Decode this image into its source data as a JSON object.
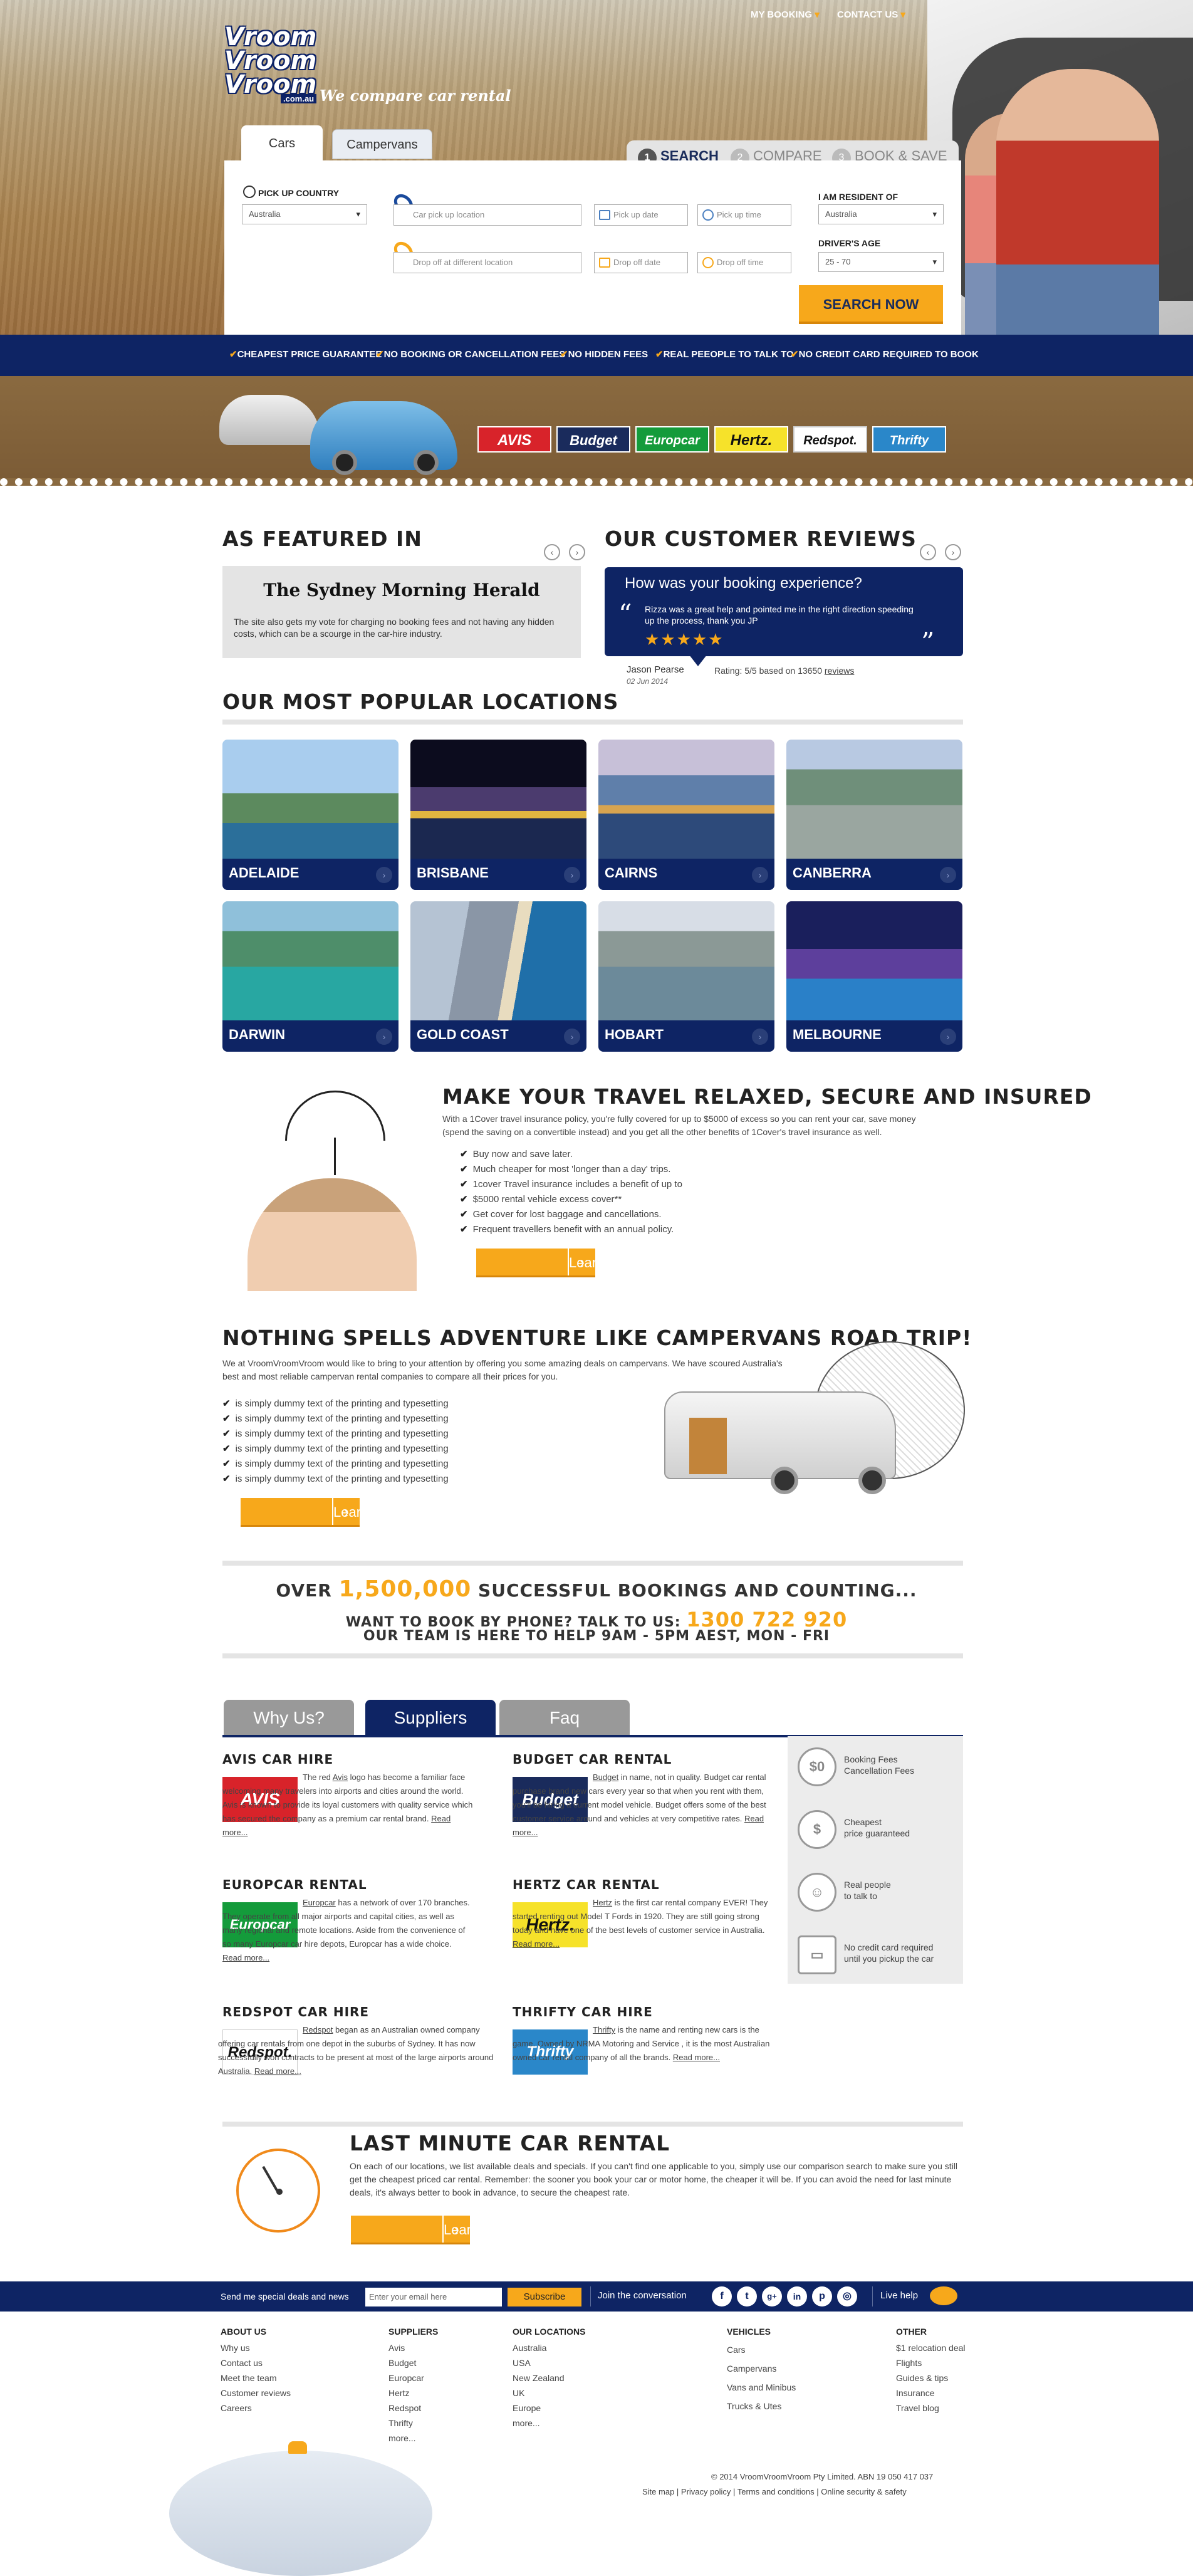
{
  "header": {
    "nav": [
      "MY BOOKING",
      "CONTACT US"
    ],
    "logo_lines": [
      "Vroom",
      "Vroom",
      "Vroom"
    ],
    "logo_domain": ".com.au",
    "tagline": "We compare car rental"
  },
  "search": {
    "tabs": [
      "Cars",
      "Campervans"
    ],
    "steps": [
      {
        "n": "1",
        "label": "SEARCH"
      },
      {
        "n": "2",
        "label": "COMPARE"
      },
      {
        "n": "3",
        "label": "BOOK & SAVE"
      }
    ],
    "pickup_country_label": "PICK UP COUNTRY",
    "pickup_country_value": "Australia",
    "pickup_location_placeholder": "Car pick up location",
    "dropoff_location_placeholder": "Drop off at different location",
    "pickup_date_placeholder": "Pick up date",
    "pickup_time_placeholder": "Pick up time",
    "dropoff_date_placeholder": "Drop off date",
    "dropoff_time_placeholder": "Drop off time",
    "resident_label": "I AM RESIDENT OF",
    "resident_value": "Australia",
    "age_label": "DRIVER'S AGE",
    "age_value": "25 - 70",
    "search_button": "SEARCH NOW"
  },
  "usps": [
    "CHEAPEST PRICE GUARANTEE",
    "NO BOOKING OR CANCELLATION FEES",
    "NO HIDDEN FEES",
    "REAL PEEOPLE TO TALK TO",
    "NO CREDIT CARD REQUIRED TO BOOK"
  ],
  "brands": [
    "AVIS",
    "Budget",
    "Europcar",
    "Hertz.",
    "Redspot.",
    "Thrifty"
  ],
  "featured": {
    "title": "AS FEATURED IN",
    "paper": "The Sydney Morning Herald",
    "quote": "The site also gets my vote for charging no booking fees and not having any hidden costs, which can be a scourge in the car-hire industry."
  },
  "reviews": {
    "title": "OUR CUSTOMER REVIEWS",
    "question": "How was your booking experience?",
    "text": "Rizza was a great help and pointed me in the right direction speeding up the process, thank you JP",
    "stars": 5,
    "author": "Jason Pearse",
    "date": "02 Jun 2014",
    "rating_text": "Rating: 5/5 based on 13650",
    "reviews_link": "reviews"
  },
  "locations": {
    "title": "OUR MOST POPULAR LOCATIONS",
    "items": [
      "ADELAIDE",
      "BRISBANE",
      "CAIRNS",
      "CANBERRA",
      "DARWIN",
      "GOLD COAST",
      "HOBART",
      "MELBOURNE"
    ]
  },
  "insurance": {
    "title": "MAKE YOUR TRAVEL RELAXED, SECURE AND INSURED",
    "intro": "With a 1Cover travel insurance policy, you're fully covered for up to $5000 of excess so you can rent your car, save money (spend the saving on a convertible instead) and you get all the other benefits of 1Cover's travel insurance as well.",
    "points": [
      "Buy now and save later.",
      "Much cheaper for most 'longer than a day' trips.",
      "1cover Travel insurance includes a benefit of up to",
      "$5000 rental vehicle excess cover**",
      "Get cover for lost baggage and cancellations.",
      "Frequent travellers benefit with an annual policy."
    ],
    "button": "Learn more"
  },
  "campervans": {
    "title": "NOTHING SPELLS ADVENTURE LIKE CAMPERVANS ROAD TRIP!",
    "intro": "We at VroomVroomVroom would like to bring to your attention by offering you some amazing deals on campervans. We have scoured Australia's best and most reliable campervan rental companies to compare all their prices for you.",
    "points": [
      "is simply dummy text of the printing and typesetting",
      "is simply dummy text of the printing and typesetting",
      "is simply dummy text of the printing and typesetting",
      "is simply dummy text of the printing and typesetting",
      "is simply dummy text of the printing and typesetting",
      "is simply dummy text of the printing and typesetting"
    ],
    "button": "Learn more"
  },
  "stats": {
    "line1_pre": "OVER",
    "bookings": "1,500,000",
    "line1_post": "SUCCESSFUL BOOKINGS AND COUNTING...",
    "line2_pre": "WANT TO BOOK BY PHONE? TALK TO US:",
    "phone": "1300 722 920",
    "line3": "OUR TEAM IS HERE TO HELP 9AM - 5PM AEST, MON - FRI"
  },
  "info_tabs": [
    "Why Us?",
    "Suppliers",
    "Faq"
  ],
  "suppliers": [
    {
      "title": "AVIS CAR HIRE",
      "logo": "AVIS",
      "text_pre": "The red ",
      "link": "Avis",
      "text": " logo has become a familiar face welcoming many travelers into airports and cities around the world. Avis is known to provide its loyal customers with quality service which has secured the company as a premium car rental brand.",
      "more": "Read more..."
    },
    {
      "title": "BUDGET CAR RENTAL",
      "logo": "Budget",
      "text_pre": "",
      "link": "Budget",
      "text": " in name, not in quality. Budget car rental purchase brand new cars every year so that when you rent with them, you'll be hiring a current model vehicle. Budget offers some of the best customer service around and vehicles at very competitive rates.",
      "more": "Read more..."
    },
    {
      "title": "EUROPCAR RENTAL",
      "logo": "Europcar",
      "text_pre": "",
      "link": "Europcar",
      "text": " has a network of over 170 branches. They operate from all major airports and capital cities, as well as many regional and remote locations. Aside from the convenience of so many Europcar car hire depots, Europcar has a wide choice.",
      "more": "Read more..."
    },
    {
      "title": "HERTZ CAR RENTAL",
      "logo": "Hertz.",
      "text_pre": "",
      "link": "Hertz",
      "text": " is the first car rental company EVER! They started renting out Model T Fords in 1920. They are still going strong today and have one of the best levels of customer service in Australia.",
      "more": "Read more..."
    },
    {
      "title": "REDSPOT CAR HIRE",
      "logo": "Redspot.",
      "text_pre": "",
      "link": "Redspot",
      "text": " began as an Australian owned company offering car rentals from one depot in the suburbs of Sydney. It has now successfully won contracts to be present at most of the large airports around Australia.",
      "more": "Read more..."
    },
    {
      "title": "THRIFTY CAR HIRE",
      "logo": "Thrifty",
      "text_pre": "",
      "link": "Thrifty",
      "text": " is the name and renting new cars is the game. Owned by NRMA Motoring and Service , it is the most Australian owned car rental company of all the brands.",
      "more": "Read more..."
    }
  ],
  "why": [
    {
      "icon": "$0",
      "text": "Booking Fees\nCancellation Fees"
    },
    {
      "icon": "$",
      "text": "Cheapest\nprice guaranteed"
    },
    {
      "icon": "☺",
      "text": "Real people\nto talk to"
    },
    {
      "icon": "▭",
      "text": "No credit card required\nuntil you pickup the car"
    }
  ],
  "lastminute": {
    "title": "LAST MINUTE CAR RENTAL",
    "text": "On each of our locations, we list available deals and specials. If you can't find one applicable to you, simply use our comparison search to make sure you still get the cheapest priced car rental. Remember: the sooner you book your car or motor home, the cheaper it will be. If you can avoid the need for last minute deals, it's always better to book in advance, to secure the cheapest rate.",
    "button": "Learn more"
  },
  "newsletter": {
    "label": "Send me special deals and news",
    "placeholder": "Enter your email here",
    "button": "Subscribe",
    "join": "Join the conversation",
    "social": [
      "f",
      "t",
      "g+",
      "in",
      "p",
      "◎"
    ],
    "live_help": "Live help"
  },
  "footer": {
    "columns": [
      {
        "title": "ABOUT US",
        "links": [
          "Why us",
          "Contact us",
          "Meet the team",
          "Customer reviews",
          "Careers"
        ]
      },
      {
        "title": "SUPPLIERS",
        "links": [
          "Avis",
          "Budget",
          "Europcar",
          "Hertz",
          "Redspot",
          "Thrifty",
          "more..."
        ]
      },
      {
        "title": "OUR LOCATIONS",
        "links": [
          "Australia",
          "USA",
          "New Zealand",
          "UK",
          "Europe",
          "more..."
        ]
      },
      {
        "title": "VEHICLES",
        "links": [
          "Cars",
          "Campervans",
          "Vans and Minibus",
          "Trucks & Utes"
        ]
      },
      {
        "title": "OTHER",
        "links": [
          "$1 relocation deal",
          "Flights",
          "Guides & tips",
          "Insurance",
          "Travel blog"
        ]
      }
    ],
    "copyright": "© 2014 VroomVroomVroom Pty Limited. ABN 19 050 417 037",
    "bottom_links": [
      "Site map",
      "Privacy policy",
      "Terms and conditions",
      "Online security & safety"
    ]
  },
  "colors": {
    "navy": "#0e2464",
    "orange": "#f7a81b",
    "grey": "#e4e4e4"
  }
}
